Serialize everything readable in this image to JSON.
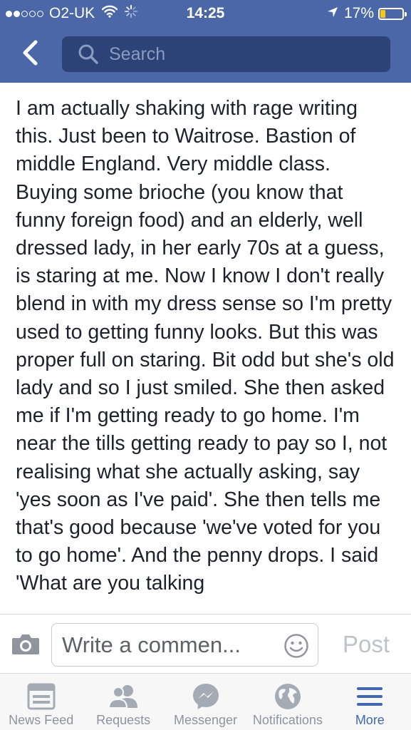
{
  "status_bar": {
    "carrier": "O2-UK",
    "time": "14:25",
    "battery_percent": "17%",
    "battery_level": 0.17,
    "signal_bars_filled": 2,
    "signal_bars_total": 5,
    "icons": [
      "wifi-icon",
      "loading-spinner-icon",
      "location-arrow-icon",
      "battery-icon"
    ]
  },
  "nav": {
    "back_icon": "chevron-left-icon",
    "search_placeholder": "Search"
  },
  "post": {
    "text": "I am actually shaking with rage writing this. Just been to Waitrose. Bastion of middle England. Very middle class. Buying some brioche (you know that funny foreign food) and an elderly, well dressed lady, in her early 70s at a guess, is staring at me. Now I know I don't really blend in with my dress sense so I'm pretty used to getting funny looks. But this was proper full on staring. Bit odd but she's old lady and so I just smiled. She then asked me if I'm getting ready to go home. I'm near the tills getting ready to pay so I, not realising what she actually asking, say 'yes soon as I've paid'. She then tells me that's good because 'we've voted for you to go home'. And the penny drops. I said 'What are you talking"
  },
  "comment_bar": {
    "camera_icon": "camera-icon",
    "placeholder": "Write a commen...",
    "emoji_icon": "smiley-icon",
    "post_label": "Post"
  },
  "tabs": [
    {
      "label": "News Feed",
      "icon": "news-feed-icon",
      "active": false
    },
    {
      "label": "Requests",
      "icon": "friend-requests-icon",
      "active": false
    },
    {
      "label": "Messenger",
      "icon": "messenger-icon",
      "active": false
    },
    {
      "label": "Notifications",
      "icon": "globe-icon",
      "active": false
    },
    {
      "label": "More",
      "icon": "hamburger-menu-icon",
      "active": true
    }
  ],
  "colors": {
    "header_blue": "#4b67a7",
    "search_bg": "#2d4377",
    "active_tab": "#4267b2",
    "inactive_tab": "#8d949e",
    "battery_fill": "#f5c518"
  }
}
